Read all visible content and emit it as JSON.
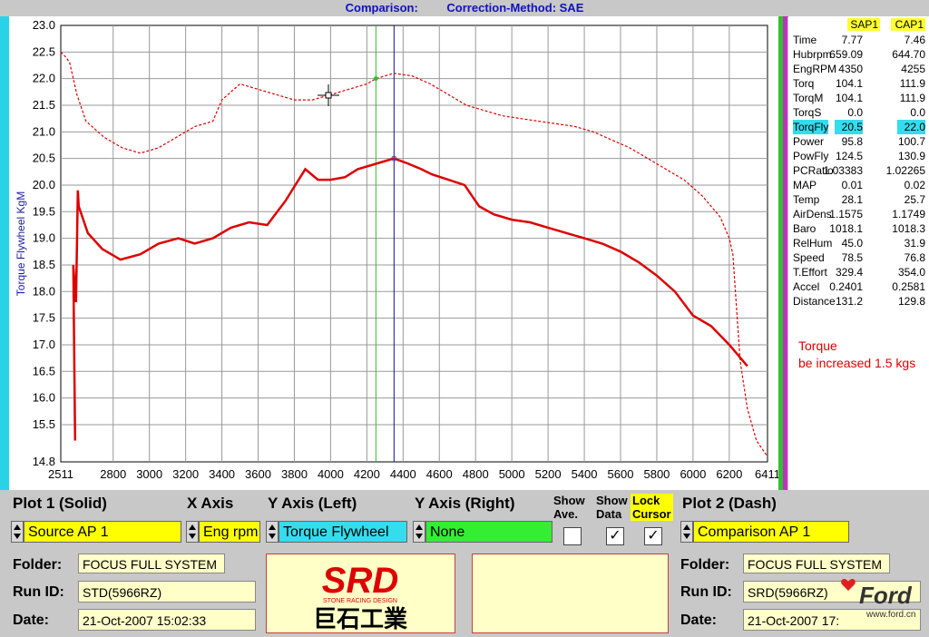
{
  "title": {
    "comparison": "Comparison:",
    "method": "Correction-Method: SAE"
  },
  "chart_data": {
    "type": "line",
    "ylabel": "Torque Flywheel KgM",
    "xlabel": "",
    "xlim": [
      2511,
      6411
    ],
    "ylim": [
      14.8,
      23.0
    ],
    "x_ticks": [
      "2511",
      "2800",
      "3000",
      "3200",
      "3400",
      "3600",
      "3800",
      "4000",
      "4200",
      "4400",
      "4600",
      "4800",
      "5000",
      "5200",
      "5400",
      "5600",
      "5800",
      "6000",
      "6200",
      "6411"
    ],
    "y_ticks": [
      "23.0",
      "22.5",
      "22.0",
      "21.5",
      "21.0",
      "20.5",
      "20.0",
      "19.5",
      "19.0",
      "18.5",
      "18.0",
      "17.5",
      "17.0",
      "16.5",
      "16.0",
      "15.5",
      "14.8"
    ],
    "grid": true,
    "series": [
      {
        "style": "solid",
        "color": "#dd0000",
        "x": [
          2590,
          2580,
          2595,
          2605,
          2610,
          2660,
          2740,
          2840,
          2950,
          3050,
          3160,
          3250,
          3350,
          3450,
          3550,
          3650,
          3750,
          3860,
          3930,
          4000,
          4080,
          4150,
          4250,
          4350,
          4430,
          4500,
          4560,
          4650,
          4740,
          4820,
          4900,
          5000,
          5100,
          5200,
          5300,
          5400,
          5500,
          5600,
          5700,
          5800,
          5900,
          6000,
          6100,
          6200,
          6300
        ],
        "y": [
          15.2,
          18.5,
          17.8,
          19.9,
          19.6,
          19.1,
          18.8,
          18.6,
          18.7,
          18.9,
          19.0,
          18.9,
          19.0,
          19.2,
          19.3,
          19.25,
          19.7,
          20.3,
          20.1,
          20.1,
          20.15,
          20.3,
          20.4,
          20.5,
          20.4,
          20.3,
          20.2,
          20.1,
          20.0,
          19.6,
          19.45,
          19.35,
          19.3,
          19.2,
          19.1,
          19.0,
          18.9,
          18.75,
          18.55,
          18.3,
          18.0,
          17.55,
          17.35,
          17.0,
          16.6
        ]
      },
      {
        "style": "dash",
        "color": "#dd0000",
        "x": [
          2511,
          2540,
          2560,
          2600,
          2650,
          2750,
          2850,
          2950,
          3050,
          3150,
          3250,
          3350,
          3400,
          3500,
          3600,
          3700,
          3800,
          3900,
          4000,
          4100,
          4200,
          4250,
          4300,
          4350,
          4450,
          4550,
          4650,
          4750,
          4850,
          4950,
          5050,
          5150,
          5250,
          5350,
          5450,
          5550,
          5650,
          5750,
          5850,
          5950,
          6050,
          6150,
          6200,
          6220,
          6260,
          6300,
          6350,
          6411
        ],
        "y": [
          22.5,
          22.4,
          22.3,
          21.7,
          21.2,
          20.9,
          20.7,
          20.6,
          20.7,
          20.9,
          21.1,
          21.2,
          21.6,
          21.9,
          21.8,
          21.7,
          21.6,
          21.6,
          21.7,
          21.8,
          21.9,
          22.0,
          22.05,
          22.1,
          22.05,
          21.9,
          21.7,
          21.5,
          21.4,
          21.3,
          21.25,
          21.2,
          21.15,
          21.1,
          21.0,
          20.85,
          20.7,
          20.5,
          20.3,
          20.1,
          19.8,
          19.4,
          19.0,
          18.7,
          16.7,
          15.8,
          15.2,
          14.9
        ]
      }
    ]
  },
  "readout": {
    "headers": [
      "SAP1",
      "CAP1"
    ],
    "rows": [
      {
        "name": "Time",
        "v1": "7.77",
        "v2": "7.46"
      },
      {
        "name": "Hubrpm",
        "v1": "659.09",
        "v2": "644.70"
      },
      {
        "name": "EngRPM",
        "v1": "4350",
        "v2": "4255"
      },
      {
        "name": "Torq",
        "v1": "104.1",
        "v2": "111.9"
      },
      {
        "name": "TorqM",
        "v1": "104.1",
        "v2": "111.9"
      },
      {
        "name": "TorqS",
        "v1": "0.0",
        "v2": "0.0"
      },
      {
        "name": "TorqFly",
        "v1": "20.5",
        "v2": "22.0"
      },
      {
        "name": "Power",
        "v1": "95.8",
        "v2": "100.7"
      },
      {
        "name": "PowFly",
        "v1": "124.5",
        "v2": "130.9"
      },
      {
        "name": "PCRatio",
        "v1": "1.03383",
        "v2": "1.02265"
      },
      {
        "name": "MAP",
        "v1": "0.01",
        "v2": "0.02"
      },
      {
        "name": "Temp",
        "v1": "28.1",
        "v2": "25.7"
      },
      {
        "name": "AirDens",
        "v1": "1.1575",
        "v2": "1.1749"
      },
      {
        "name": "Baro",
        "v1": "1018.1",
        "v2": "1018.3"
      },
      {
        "name": "RelHum",
        "v1": "45.0",
        "v2": "31.9"
      },
      {
        "name": "Speed",
        "v1": "78.5",
        "v2": "76.8"
      },
      {
        "name": "T.Effort",
        "v1": "329.4",
        "v2": "354.0"
      },
      {
        "name": "Accel",
        "v1": "0.2401",
        "v2": "0.2581"
      },
      {
        "name": "Distance",
        "v1": "131.2",
        "v2": "129.8"
      }
    ],
    "highlight_index": 6
  },
  "note": {
    "line1": "Torque",
    "line2": "be increased 1.5 kgs"
  },
  "controls": {
    "plot1_label": "Plot 1 (Solid)",
    "xaxis_label": "X Axis",
    "yleft_label": "Y Axis (Left)",
    "yright_label": "Y Axis (Right)",
    "show_ave_label1": "Show",
    "show_ave_label2": "Ave.",
    "show_data_label1": "Show",
    "show_data_label2": "Data",
    "lock_cursor_label1": "Lock",
    "lock_cursor_label2": "Cursor",
    "plot2_label": "Plot 2 (Dash)",
    "plot1_source": "Source AP 1",
    "xaxis_value": "Eng rpm",
    "yleft_value": "Torque Flywheel",
    "yright_value": "None",
    "plot2_source": "Comparison AP 1",
    "show_ave_checked": "",
    "show_data_checked": "✓",
    "lock_cursor_checked": "✓"
  },
  "left_info": {
    "folder_label": "Folder:",
    "folder": "FOCUS FULL SYSTEM",
    "runid_label": "Run ID:",
    "runid": "STD(5966RZ)",
    "date_label": "Date:",
    "date": "21-Oct-2007  15:02:33"
  },
  "right_info": {
    "folder_label": "Folder:",
    "folder": "FOCUS FULL SYSTEM",
    "runid_label": "Run ID:",
    "runid": "SRD(5966RZ)",
    "date_label": "Date:",
    "date": "21-Oct-2007  17:"
  },
  "logo": {
    "brand": "SRD",
    "tagline": "STONE RACING DESIGN",
    "chinese": "巨石工業"
  },
  "watermark": {
    "brand": "Ford",
    "site": "www.ford.cn"
  },
  "colors": {
    "solid": "#dd0000",
    "dash": "#dd0000",
    "cursor_green": "#30c030",
    "cursor_blue": "#1010a0",
    "accent_yellow": "#ffff00",
    "accent_cyan": "#33ddee",
    "accent_green": "#33ee33"
  }
}
